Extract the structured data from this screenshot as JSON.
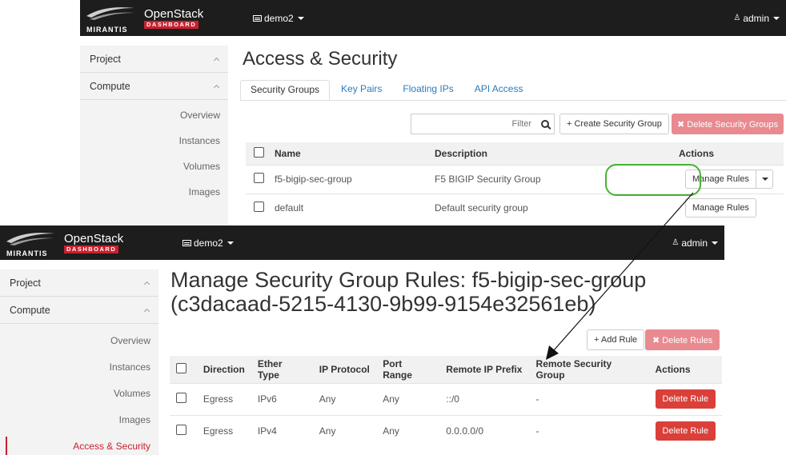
{
  "back_window": {
    "brand": {
      "mirantis": "MIRANTIS",
      "openstack": "OpenStack",
      "dashboard": "DASHBOARD"
    },
    "project_selector": "demo2",
    "user": "admin",
    "sidebar": {
      "project": "Project",
      "compute": "Compute",
      "items": [
        "Overview",
        "Instances",
        "Volumes",
        "Images"
      ]
    },
    "page_title": "Access & Security",
    "tabs": [
      "Security Groups",
      "Key Pairs",
      "Floating IPs",
      "API Access"
    ],
    "filter_placeholder": "Filter",
    "create_button": "+ Create Security Group",
    "delete_button": "✖ Delete Security Groups",
    "table": {
      "headers": [
        "Name",
        "Description",
        "Actions"
      ],
      "rows": [
        {
          "name": "f5-bigip-sec-group",
          "description": "F5 BIGIP Security Group",
          "action": "Manage Rules"
        },
        {
          "name": "default",
          "description": "Default security group",
          "action": "Manage Rules"
        }
      ]
    }
  },
  "front_window": {
    "brand": {
      "mirantis": "MIRANTIS",
      "openstack": "OpenStack",
      "dashboard": "DASHBOARD"
    },
    "project_selector": "demo2",
    "user": "admin",
    "sidebar": {
      "project": "Project",
      "compute": "Compute",
      "items": [
        "Overview",
        "Instances",
        "Volumes",
        "Images"
      ],
      "active": "Access & Security"
    },
    "page_title_line1": "Manage Security Group Rules: f5-bigip-sec-group",
    "page_title_line2": "(c3dacaad-5215-4130-9b99-9154e32561eb)",
    "add_rule_button": "+ Add Rule",
    "delete_rules_button": "✖ Delete Rules",
    "table": {
      "headers": [
        "Direction",
        "Ether Type",
        "IP Protocol",
        "Port Range",
        "Remote IP Prefix",
        "Remote Security Group",
        "Actions"
      ],
      "rows": [
        {
          "direction": "Egress",
          "ether_type": "IPv6",
          "ip_protocol": "Any",
          "port_range": "Any",
          "remote_ip_prefix": "::/0",
          "remote_security_group": "-",
          "action": "Delete Rule"
        },
        {
          "direction": "Egress",
          "ether_type": "IPv4",
          "ip_protocol": "Any",
          "port_range": "Any",
          "remote_ip_prefix": "0.0.0.0/0",
          "remote_security_group": "-",
          "action": "Delete Rule"
        }
      ]
    }
  },
  "colors": {
    "navbar": "#1d1d1d",
    "brand_red": "#c8212f",
    "link_blue": "#2a7bbd",
    "danger": "#d9403a",
    "highlight_green": "#47b233"
  }
}
